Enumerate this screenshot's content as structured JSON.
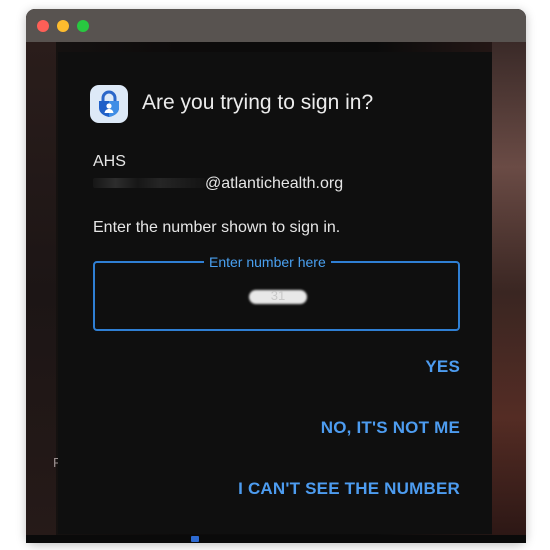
{
  "window": {
    "traffic_lights": [
      "close",
      "minimize",
      "zoom"
    ],
    "colors": {
      "close": "#fe5f57",
      "minimize": "#febc2e",
      "zoom": "#28c840"
    }
  },
  "background": {
    "partial_letter": "F"
  },
  "dialog": {
    "app_icon": "authenticator-lock-icon",
    "title": "Are you trying to sign in?",
    "organization": "AHS",
    "email_visible": "@atlantichealth.org",
    "instruction": "Enter the number shown to sign in.",
    "number_field": {
      "label": "Enter number here",
      "value": "31"
    },
    "actions": {
      "yes": "YES",
      "no": "NO, IT'S NOT ME",
      "cant_see": "I CAN'T SEE THE NUMBER"
    },
    "accent_color": "#4d9cf0"
  }
}
